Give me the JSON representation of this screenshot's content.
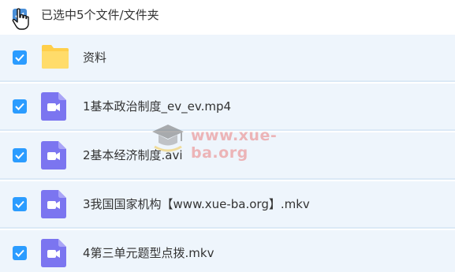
{
  "selection": {
    "summary": "已选中5个文件/文件夹"
  },
  "files": [
    {
      "name": "资料",
      "icon": "folder-icon"
    },
    {
      "name": "1基本政治制度_ev_ev.mp4",
      "icon": "video-file-icon"
    },
    {
      "name": "2基本经济制度.avi",
      "icon": "video-file-icon"
    },
    {
      "name": "3我国国家机构【www.xue-ba.org】.mkv",
      "icon": "video-file-icon"
    },
    {
      "name": "4第三单元题型点拨.mkv",
      "icon": "video-file-icon"
    }
  ],
  "watermark": {
    "text": "www.xue-ba.org"
  },
  "colors": {
    "checkbox": "#2b9cff",
    "row_background": "#eef5fc",
    "folder": "#ffd455",
    "video_icon": "#7b75f0"
  }
}
